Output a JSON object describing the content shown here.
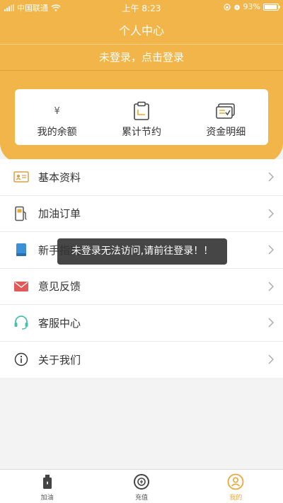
{
  "status_bar": {
    "carrier": "中国联通",
    "time": "上午 8:23",
    "battery": "93%",
    "battery_level": 0.93
  },
  "header": {
    "title": "个人中心",
    "login_prompt": "未登录，点击登录"
  },
  "summary": {
    "balance_value": "¥",
    "items": [
      {
        "label": "我的余额",
        "icon": "yen-icon"
      },
      {
        "label": "累计节约",
        "icon": "clipboard-icon"
      },
      {
        "label": "资金明细",
        "icon": "ledger-icon"
      }
    ]
  },
  "menu": [
    {
      "label": "基本资料",
      "icon": "id-card-icon"
    },
    {
      "label": "加油订单",
      "icon": "fuel-pump-icon"
    },
    {
      "label": "新手指南",
      "icon": "book-icon"
    },
    {
      "label": "意见反馈",
      "icon": "mail-icon"
    },
    {
      "label": "客服中心",
      "icon": "headset-icon"
    },
    {
      "label": "关于我们",
      "icon": "info-icon"
    }
  ],
  "toast": "未登录无法访问,请前往登录！！",
  "tabbar": {
    "active": "我的",
    "items": [
      {
        "label": "加油",
        "icon": "fuel-icon"
      },
      {
        "label": "充值",
        "icon": "recharge-icon"
      },
      {
        "label": "我的",
        "icon": "user-icon"
      }
    ]
  },
  "colors": {
    "brand": "#f2b54a",
    "active_tab": "#e8a83a",
    "toast_bg": "#323232"
  }
}
